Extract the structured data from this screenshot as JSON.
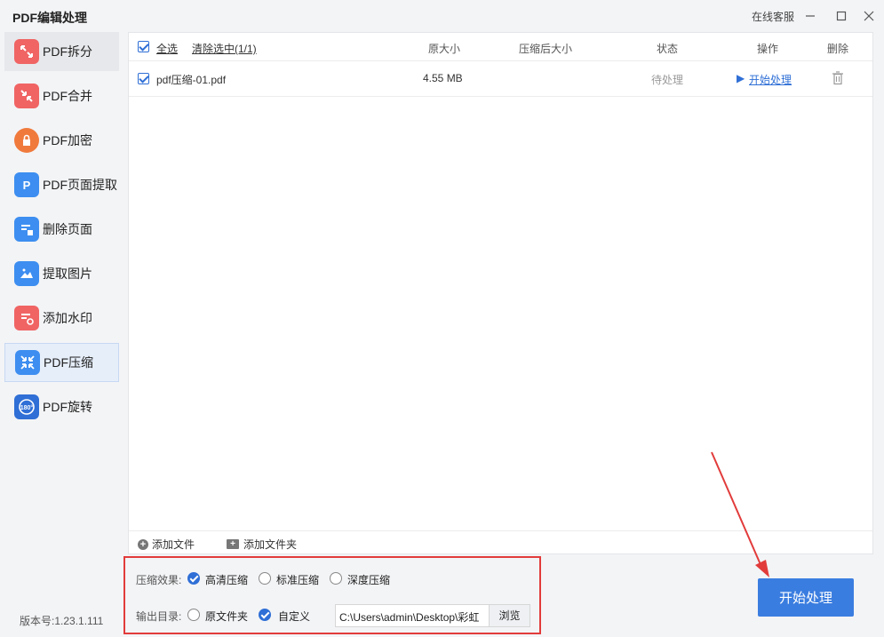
{
  "app": {
    "title": "PDF编辑处理",
    "support_label": "在线客服",
    "version": "版本号:1.23.1.111"
  },
  "sidebar": {
    "items": [
      {
        "label": "PDF拆分",
        "icon": "split-icon",
        "color": "#f06464"
      },
      {
        "label": "PDF合并",
        "icon": "merge-icon",
        "color": "#f06464"
      },
      {
        "label": "PDF加密",
        "icon": "lock-icon",
        "color": "#f07a3c"
      },
      {
        "label": "PDF页面提取",
        "icon": "page-extract-icon",
        "color": "#3d8ef0"
      },
      {
        "label": "删除页面",
        "icon": "delete-page-icon",
        "color": "#3d8ef0"
      },
      {
        "label": "提取图片",
        "icon": "image-extract-icon",
        "color": "#3d8ef0"
      },
      {
        "label": "添加水印",
        "icon": "watermark-icon",
        "color": "#f06464"
      },
      {
        "label": "PDF压缩",
        "icon": "compress-icon",
        "color": "#3d8ef0"
      },
      {
        "label": "PDF旋转",
        "icon": "rotate-icon",
        "color": "#2f6fd6",
        "badge": "180°"
      }
    ]
  },
  "table": {
    "select_all": "全选",
    "clear_selected": "清除选中(1/1)",
    "headers": {
      "original_size": "原大小",
      "compressed_size": "压缩后大小",
      "status": "状态",
      "action": "操作",
      "delete": "删除"
    },
    "rows": [
      {
        "name": "pdf压缩-01.pdf",
        "original_size": "4.55 MB",
        "compressed_size": "",
        "status": "待处理",
        "action": "开始处理"
      }
    ],
    "add_file": "添加文件",
    "add_folder": "添加文件夹"
  },
  "options": {
    "effect_label": "压缩效果:",
    "effects": [
      "高清压缩",
      "标准压缩",
      "深度压缩"
    ],
    "effect_selected": "高清压缩",
    "output_label": "输出目录:",
    "outputs": [
      "原文件夹",
      "自定义"
    ],
    "output_selected": "自定义",
    "path_value": "C:\\Users\\admin\\Desktop\\彩虹",
    "browse": "浏览"
  },
  "start_button": "开始处理",
  "colors": {
    "accent": "#3a7de0",
    "highlight": "#e23b3b"
  }
}
